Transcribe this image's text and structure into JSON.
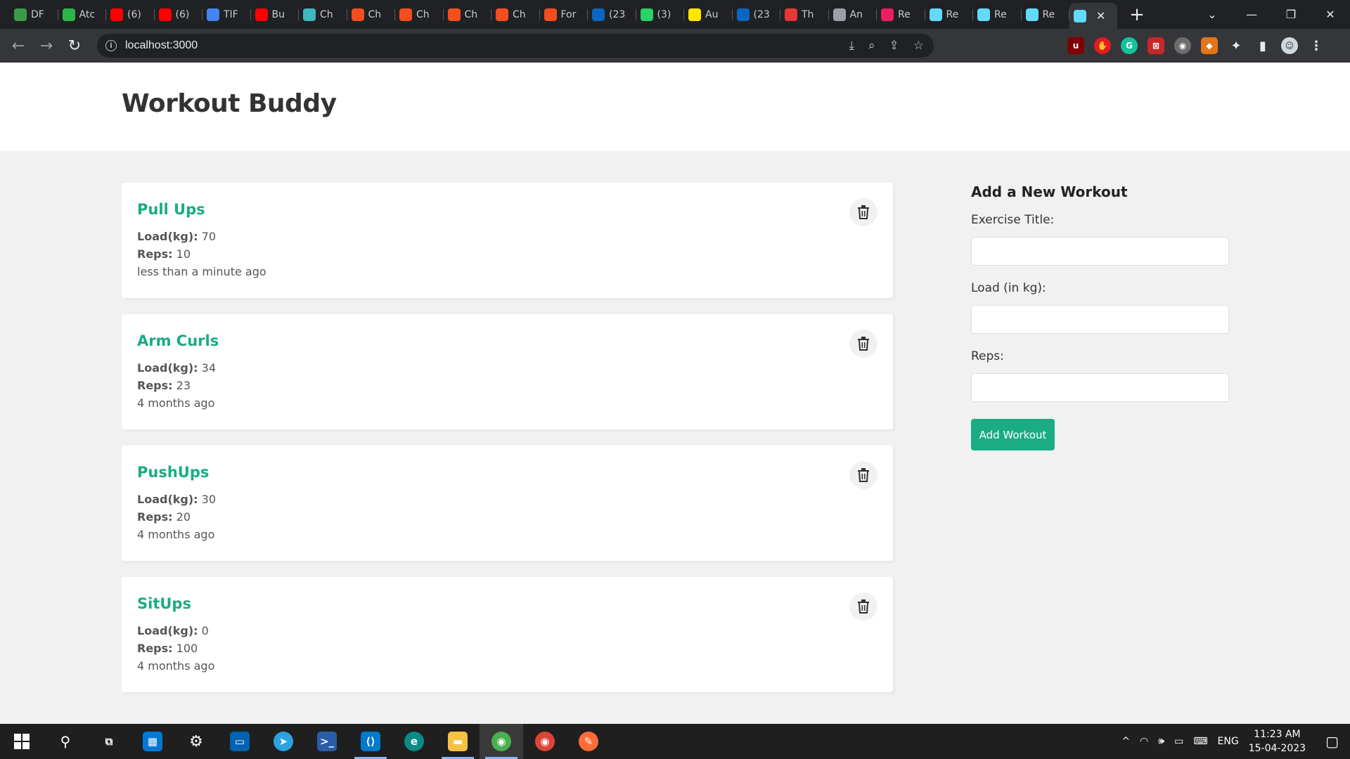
{
  "browser": {
    "tabs": [
      {
        "label": "DF",
        "icon": "infinity-icon",
        "color": "#3c9b47"
      },
      {
        "label": "Atc",
        "icon": "ac-icon",
        "color": "#2bb64a"
      },
      {
        "label": "(6)",
        "icon": "youtube-icon",
        "color": "#ff0000"
      },
      {
        "label": "(6)",
        "icon": "youtube-icon",
        "color": "#ff0000"
      },
      {
        "label": "TIF",
        "icon": "docs-icon",
        "color": "#4285f4"
      },
      {
        "label": "Bu",
        "icon": "youtube-icon",
        "color": "#ff0000"
      },
      {
        "label": "Ch",
        "icon": "lightning-icon",
        "color": "#3fb7c1"
      },
      {
        "label": "Ch",
        "icon": "figma-icon",
        "color": "#f24e1e"
      },
      {
        "label": "Ch",
        "icon": "figma-icon",
        "color": "#f24e1e"
      },
      {
        "label": "Ch",
        "icon": "figma-icon",
        "color": "#f24e1e"
      },
      {
        "label": "Ch",
        "icon": "figma-icon",
        "color": "#f24e1e"
      },
      {
        "label": "For",
        "icon": "figma-icon",
        "color": "#f24e1e"
      },
      {
        "label": "(23",
        "icon": "linkedin-icon",
        "color": "#0a66c2"
      },
      {
        "label": "(3)",
        "icon": "whatsapp-icon",
        "color": "#25d366"
      },
      {
        "label": "Au",
        "icon": "ey-icon",
        "color": "#ffe600"
      },
      {
        "label": "(23",
        "icon": "linkedin-icon",
        "color": "#0a66c2"
      },
      {
        "label": "Th",
        "icon": "pin-icon",
        "color": "#e53935"
      },
      {
        "label": "An",
        "icon": "avatar-icon",
        "color": "#9aa0a6"
      },
      {
        "label": "Re",
        "icon": "react-icon",
        "color": "#e91e63"
      },
      {
        "label": "Re",
        "icon": "react-icon",
        "color": "#61dafb"
      },
      {
        "label": "Re",
        "icon": "react-icon",
        "color": "#61dafb"
      },
      {
        "label": "Re",
        "icon": "react-icon",
        "color": "#61dafb"
      }
    ],
    "active_tab_icon": "react-icon",
    "url": "localhost:3000"
  },
  "app": {
    "title": "Workout Buddy",
    "accent_color": "#1aac83"
  },
  "workouts": [
    {
      "title": "Pull Ups",
      "load_label": "Load(kg):",
      "load": "70",
      "reps_label": "Reps:",
      "reps": "10",
      "time": "less than a minute ago"
    },
    {
      "title": "Arm Curls",
      "load_label": "Load(kg):",
      "load": "34",
      "reps_label": "Reps:",
      "reps": "23",
      "time": "4 months ago"
    },
    {
      "title": "PushUps",
      "load_label": "Load(kg):",
      "load": "30",
      "reps_label": "Reps:",
      "reps": "20",
      "time": "4 months ago"
    },
    {
      "title": "SitUps",
      "load_label": "Load(kg):",
      "load": "0",
      "reps_label": "Reps:",
      "reps": "100",
      "time": "4 months ago"
    }
  ],
  "form": {
    "heading": "Add a New Workout",
    "title_label": "Exercise Title:",
    "title_value": "",
    "load_label": "Load (in kg):",
    "load_value": "",
    "reps_label": "Reps:",
    "reps_value": "",
    "submit_label": "Add Workout"
  },
  "taskbar": {
    "language": "ENG",
    "time": "11:23 AM",
    "date": "15-04-2023"
  }
}
